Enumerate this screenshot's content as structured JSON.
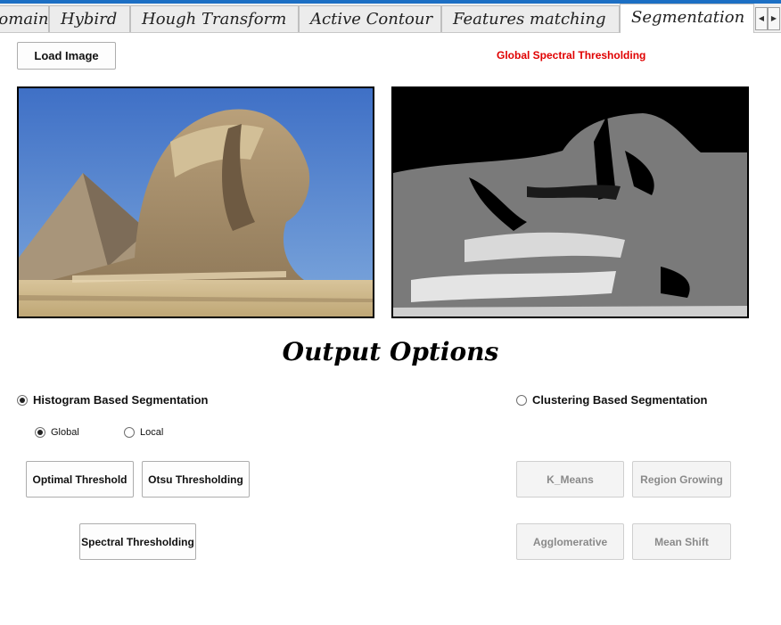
{
  "tabs": [
    {
      "label": "Domain",
      "active": false
    },
    {
      "label": "Hybird",
      "active": false
    },
    {
      "label": "Hough Transform",
      "active": false
    },
    {
      "label": "Active Contour",
      "active": false
    },
    {
      "label": "Features matching",
      "active": false
    },
    {
      "label": "Segmentation",
      "active": true
    }
  ],
  "tab_scroll": {
    "left": "◀",
    "right": "▶"
  },
  "toolbar": {
    "load_label": "Load Image"
  },
  "output_label": "Global Spectral Thresholding",
  "colors": {
    "accent": "#1c6fc4",
    "label_red": "#e00000"
  },
  "section_title": "Output Options",
  "histogram": {
    "label": "Histogram Based Segmentation",
    "checked": true,
    "global_label": "Global",
    "local_label": "Local",
    "global_checked": true,
    "buttons": {
      "optimal": "Optimal Threshold",
      "otsu": "Otsu Thresholding",
      "spectral": "Spectral Thresholding"
    }
  },
  "clustering": {
    "label": "Clustering Based Segmentation",
    "checked": false,
    "buttons": {
      "kmeans": "K_Means",
      "region": "Region Growing",
      "agglomerative": "Agglomerative",
      "meanshift": "Mean Shift"
    }
  }
}
